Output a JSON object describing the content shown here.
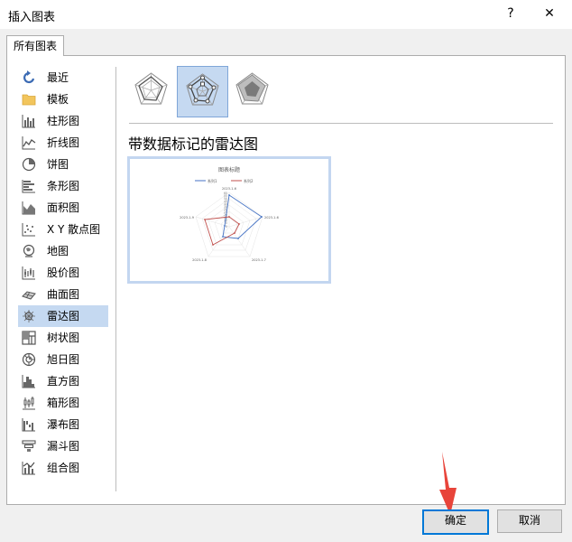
{
  "window": {
    "title": "插入图表",
    "help_label": "?",
    "close_label": "✕"
  },
  "tabs": [
    {
      "label": "所有图表"
    }
  ],
  "sidebar": {
    "items": [
      {
        "label": "最近",
        "icon": "recent-icon"
      },
      {
        "label": "模板",
        "icon": "template-folder-icon"
      },
      {
        "label": "柱形图",
        "icon": "column-chart-icon"
      },
      {
        "label": "折线图",
        "icon": "line-chart-icon"
      },
      {
        "label": "饼图",
        "icon": "pie-chart-icon"
      },
      {
        "label": "条形图",
        "icon": "bar-chart-icon"
      },
      {
        "label": "面积图",
        "icon": "area-chart-icon"
      },
      {
        "label": "X Y 散点图",
        "icon": "scatter-chart-icon"
      },
      {
        "label": "地图",
        "icon": "map-chart-icon"
      },
      {
        "label": "股价图",
        "icon": "stock-chart-icon"
      },
      {
        "label": "曲面图",
        "icon": "surface-chart-icon"
      },
      {
        "label": "雷达图",
        "icon": "radar-chart-icon",
        "selected": true
      },
      {
        "label": "树状图",
        "icon": "treemap-chart-icon"
      },
      {
        "label": "旭日图",
        "icon": "sunburst-chart-icon"
      },
      {
        "label": "直方图",
        "icon": "histogram-chart-icon"
      },
      {
        "label": "箱形图",
        "icon": "box-whisker-chart-icon"
      },
      {
        "label": "瀑布图",
        "icon": "waterfall-chart-icon"
      },
      {
        "label": "漏斗图",
        "icon": "funnel-chart-icon"
      },
      {
        "label": "组合图",
        "icon": "combo-chart-icon"
      }
    ]
  },
  "subtypes": [
    {
      "icon": "radar-subtype-icon"
    },
    {
      "icon": "radar-markers-subtype-icon",
      "selected": true
    },
    {
      "icon": "filled-radar-subtype-icon"
    }
  ],
  "main": {
    "chart_heading": "带数据标记的雷达图"
  },
  "preview": {
    "title": "图表标题",
    "legend": [
      "系列1",
      "系列2"
    ],
    "categories": [
      "2023-1-6",
      "2023-1-6",
      "2023-1-7",
      "2023-1-8",
      "2023-1-9"
    ],
    "scale_ticks": [
      "60",
      "55",
      "50",
      "45",
      "40",
      "35",
      "30",
      "25",
      "20",
      "15",
      "10",
      "5",
      "0"
    ],
    "colors": {
      "series1": "#4472c4",
      "series2": "#c0504d"
    }
  },
  "buttons": {
    "ok": "确定",
    "cancel": "取消"
  },
  "colors": {
    "selection": "#c5d9f1",
    "accent_arrow": "#e8443a"
  }
}
